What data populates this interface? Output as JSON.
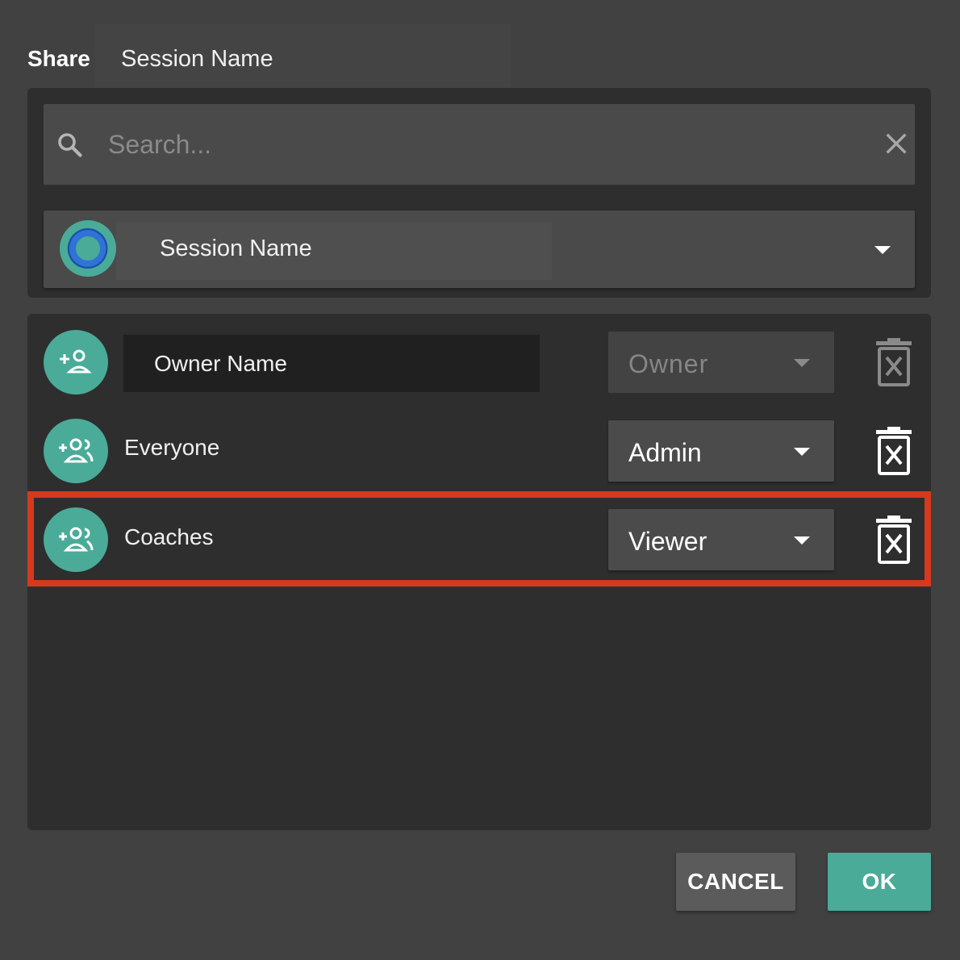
{
  "header": {
    "title": "Share",
    "session_name": "Session Name"
  },
  "search": {
    "placeholder": "Search...",
    "value": ""
  },
  "session_select": {
    "selected": "Session Name"
  },
  "members": [
    {
      "name": "Owner Name",
      "role": "Owner",
      "icon": "add-person-icon",
      "role_disabled": true
    },
    {
      "name": "Everyone",
      "role": "Admin",
      "icon": "add-group-icon",
      "role_disabled": false
    },
    {
      "name": "Coaches",
      "role": "Viewer",
      "icon": "add-group-icon",
      "role_disabled": false
    }
  ],
  "buttons": {
    "cancel": "CANCEL",
    "ok": "OK"
  },
  "colors": {
    "background": "#414141",
    "panel": "#2e2e2e",
    "accent": "#4aab98",
    "highlight_border": "#d6391f",
    "logo_blue": "#2f73d6"
  }
}
